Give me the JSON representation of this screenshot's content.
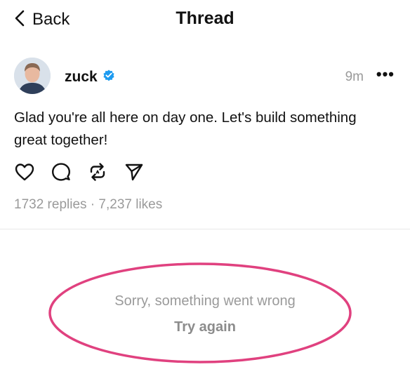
{
  "header": {
    "back_label": "Back",
    "title": "Thread"
  },
  "post": {
    "username": "zuck",
    "time": "9m",
    "more_label": "•••",
    "text": "Glad you're all here on day one. Let's build something great together!",
    "stats": "1732 replies · 7,237 likes",
    "avatar_icon": "avatar-photo",
    "verified_icon": "verified-badge-icon"
  },
  "actions": [
    {
      "name": "like",
      "icon": "heart-icon"
    },
    {
      "name": "reply",
      "icon": "comment-icon"
    },
    {
      "name": "repost",
      "icon": "repost-icon"
    },
    {
      "name": "share",
      "icon": "send-icon"
    }
  ],
  "error": {
    "message": "Sorry, something went wrong",
    "retry_label": "Try again"
  },
  "colors": {
    "verified": "#1d9bf0",
    "muted_text": "#9a9a9a",
    "annotation": "#e0417f"
  }
}
